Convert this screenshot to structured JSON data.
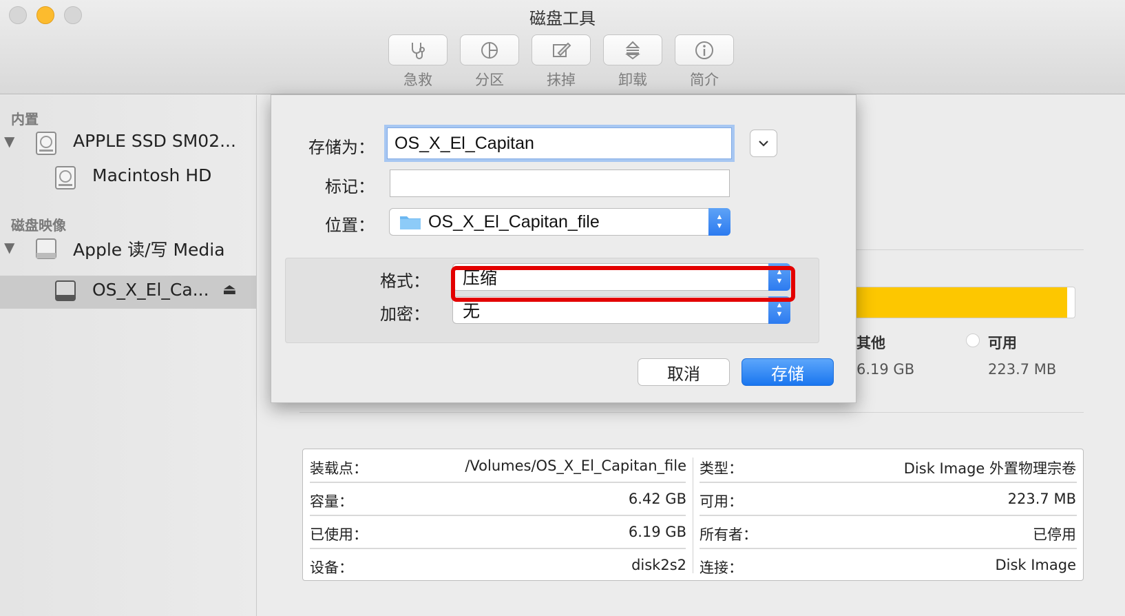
{
  "window": {
    "title": "磁盘工具"
  },
  "toolbar": [
    {
      "label": "急救",
      "icon": "stethoscope-icon"
    },
    {
      "label": "分区",
      "icon": "pie-partition-icon"
    },
    {
      "label": "抹掉",
      "icon": "erase-icon"
    },
    {
      "label": "卸载",
      "icon": "unmount-icon"
    },
    {
      "label": "简介",
      "icon": "info-icon"
    }
  ],
  "sidebar": {
    "section_internal": "内置",
    "internal_disk": "APPLE SSD SM02...",
    "internal_volume": "Macintosh HD",
    "section_images": "磁盘映像",
    "image_disk": "Apple 读/写 Media",
    "image_volume": "OS_X_El_Ca..."
  },
  "dialog": {
    "save_as_label": "存储为：",
    "save_as_value": "OS_X_El_Capitan",
    "tags_label": "标记：",
    "tags_value": "",
    "location_label": "位置：",
    "location_value": "OS_X_El_Capitan_file",
    "format_label": "格式：",
    "format_value": "压缩",
    "encryption_label": "加密：",
    "encryption_value": "无",
    "cancel_label": "取消",
    "save_label": "存储"
  },
  "usage": {
    "used_fraction": 0.965,
    "used_color": "#fdc700",
    "other_label": "其他",
    "other_value": "6.19 GB",
    "available_label": "可用",
    "available_value": "223.7 MB"
  },
  "info": {
    "left": [
      {
        "key": "装载点：",
        "value": "/Volumes/OS_X_El_Capitan_file"
      },
      {
        "key": "容量：",
        "value": "6.42 GB"
      },
      {
        "key": "已使用：",
        "value": "6.19 GB"
      },
      {
        "key": "设备：",
        "value": "disk2s2"
      }
    ],
    "right": [
      {
        "key": "类型：",
        "value": "Disk Image 外置物理宗卷"
      },
      {
        "key": "可用：",
        "value": "223.7 MB"
      },
      {
        "key": "所有者：",
        "value": "已停用"
      },
      {
        "key": "连接：",
        "value": "Disk Image"
      }
    ]
  }
}
